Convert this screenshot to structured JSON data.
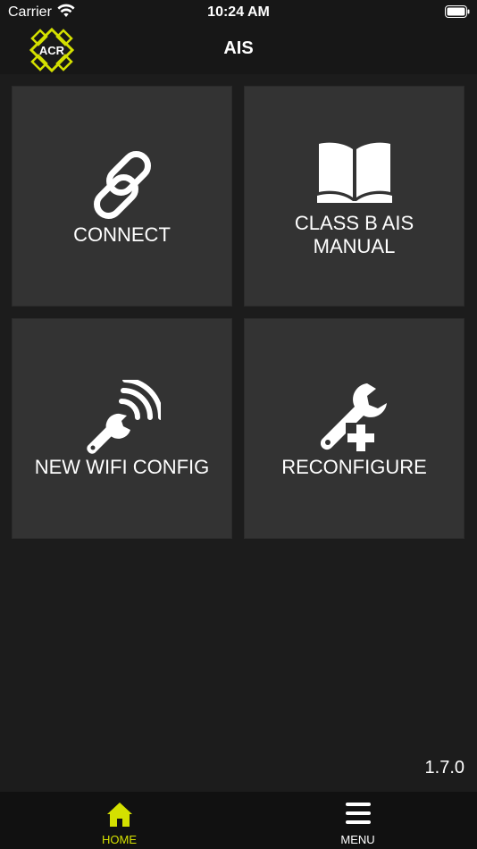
{
  "status_bar": {
    "carrier": "Carrier",
    "time": "10:24 AM",
    "wifi_icon": "wifi-icon",
    "battery_icon": "battery-icon"
  },
  "nav_bar": {
    "title": "AIS",
    "logo_text": "ACR",
    "logo_color": "#d4e000"
  },
  "tiles": [
    {
      "label": "CONNECT",
      "icon": "link-icon"
    },
    {
      "label": "CLASS B AIS MANUAL",
      "icon": "book-icon"
    },
    {
      "label": "NEW WIFI CONFIG",
      "icon": "wifi-wrench-icon"
    },
    {
      "label": "RECONFIGURE",
      "icon": "wrench-plus-icon"
    }
  ],
  "version": "1.7.0",
  "tab_bar": {
    "items": [
      {
        "label": "HOME",
        "icon": "home-icon",
        "active": true,
        "color": "#d4e000"
      },
      {
        "label": "MENU",
        "icon": "hamburger-icon",
        "active": false,
        "color": "#ffffff"
      }
    ]
  }
}
